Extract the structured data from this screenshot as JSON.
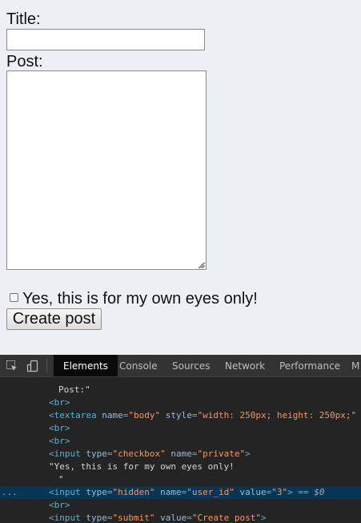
{
  "form": {
    "title_label": "Title:",
    "post_label": "Post:",
    "title_value": "",
    "post_value": "",
    "checkbox_label": "Yes, this is for my own eyes only!",
    "checkbox_checked": false,
    "submit_label": "Create post"
  },
  "devtools": {
    "tabs": [
      {
        "label": "Elements",
        "active": true
      },
      {
        "label": "Console"
      },
      {
        "label": "Sources"
      },
      {
        "label": "Network"
      },
      {
        "label": "Performance"
      },
      {
        "label": "M"
      }
    ],
    "icons": [
      "inspect-icon",
      "device-toolbar-icon"
    ],
    "code": {
      "l0": "\"",
      "l1": "Post:\"",
      "br": "<br>",
      "ta_open": "<textarea",
      "ta_name_attr": "name",
      "ta_name_val": "\"body\"",
      "ta_style_attr": "style",
      "ta_style_val": "\"width: 250px; height: 250px;\"",
      "ta_tail": "(",
      "cb_open": "<input",
      "cb_type_attr": "type",
      "cb_type_val": "\"checkbox\"",
      "cb_name_attr": "name",
      "cb_name_val": "\"private\"",
      "cb_close": ">",
      "text_node": "\"Yes, this is for my own eyes only!",
      "quote_close": "\"",
      "hid_open": "<input",
      "hid_type_attr": "type",
      "hid_type_val": "\"hidden\"",
      "hid_name_attr": "name",
      "hid_name_val": "\"user_id\"",
      "hid_value_attr": "value",
      "hid_value_val": "\"3\"",
      "hid_close": ">",
      "hid_eq": "==",
      "hid_dollar": "$0",
      "ellipsis": "...",
      "sub_open": "<input",
      "sub_type_attr": "type",
      "sub_type_val": "\"submit\"",
      "sub_value_attr": "value",
      "sub_value_val": "\"Create post\"",
      "sub_close": ">"
    }
  },
  "colors": {
    "page_bg": "#eceff4",
    "devtools_bg": "#242424",
    "tag": "#5db0d7",
    "attr_name": "#9bbbdc",
    "attr_value": "#f29766",
    "selected_row": "#073655"
  }
}
